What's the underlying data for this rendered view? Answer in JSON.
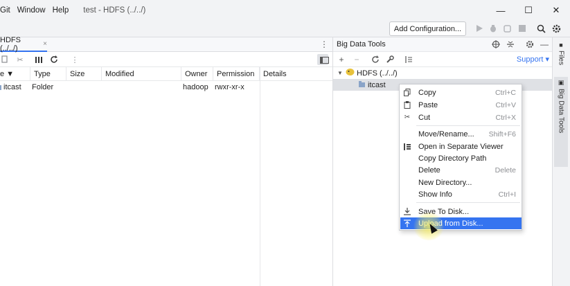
{
  "menubar": {
    "items": [
      "Git",
      "Window",
      "Help"
    ],
    "window_title": "test - HDFS (../../)"
  },
  "window_controls": {
    "minimize": "—",
    "maximize": "☐",
    "close": "✕"
  },
  "toolbar": {
    "add_config_label": "Add Configuration..."
  },
  "editor": {
    "tab_label": "HDFS (../../)",
    "tab_close": "×",
    "columns": [
      "e ▼",
      "Type",
      "Size",
      "Modified",
      "Owner",
      "Permission"
    ],
    "details_header": "Details",
    "rows": [
      {
        "name": "itcast",
        "type": "Folder",
        "size": "",
        "modified": "",
        "owner": "hadoop",
        "permission": "rwxr-xr-x"
      }
    ]
  },
  "big_data_tools": {
    "title": "Big Data Tools",
    "support_label": "Support ▾",
    "tree": [
      {
        "label": "HDFS (../../)",
        "expanded": true
      },
      {
        "label": "itcast",
        "selected": true
      }
    ]
  },
  "side_strip": {
    "files_label": "Files",
    "bdt_label": "Big Data Tools"
  },
  "context_menu": {
    "items": [
      {
        "label": "Copy",
        "shortcut": "Ctrl+C",
        "icon": "copy-icon"
      },
      {
        "label": "Paste",
        "shortcut": "Ctrl+V",
        "icon": "paste-icon"
      },
      {
        "label": "Cut",
        "shortcut": "Ctrl+X",
        "icon": "cut-icon"
      },
      {
        "label": "Move/Rename...",
        "shortcut": "Shift+F6",
        "icon": ""
      },
      {
        "label": "Open in Separate Viewer",
        "shortcut": "",
        "icon": "viewer-icon"
      },
      {
        "label": "Copy Directory Path",
        "shortcut": "",
        "icon": ""
      },
      {
        "label": "Delete",
        "shortcut": "Delete",
        "icon": ""
      },
      {
        "label": "New Directory...",
        "shortcut": "",
        "icon": ""
      },
      {
        "label": "Show Info",
        "shortcut": "Ctrl+I",
        "icon": ""
      },
      {
        "label": "Save To Disk...",
        "shortcut": "",
        "icon": "download-icon"
      },
      {
        "label": "Upload from Disk...",
        "shortcut": "",
        "icon": "upload-icon",
        "highlighted": true
      }
    ]
  },
  "colors": {
    "accent": "#3574f0",
    "selection": "#dfe1e5"
  }
}
